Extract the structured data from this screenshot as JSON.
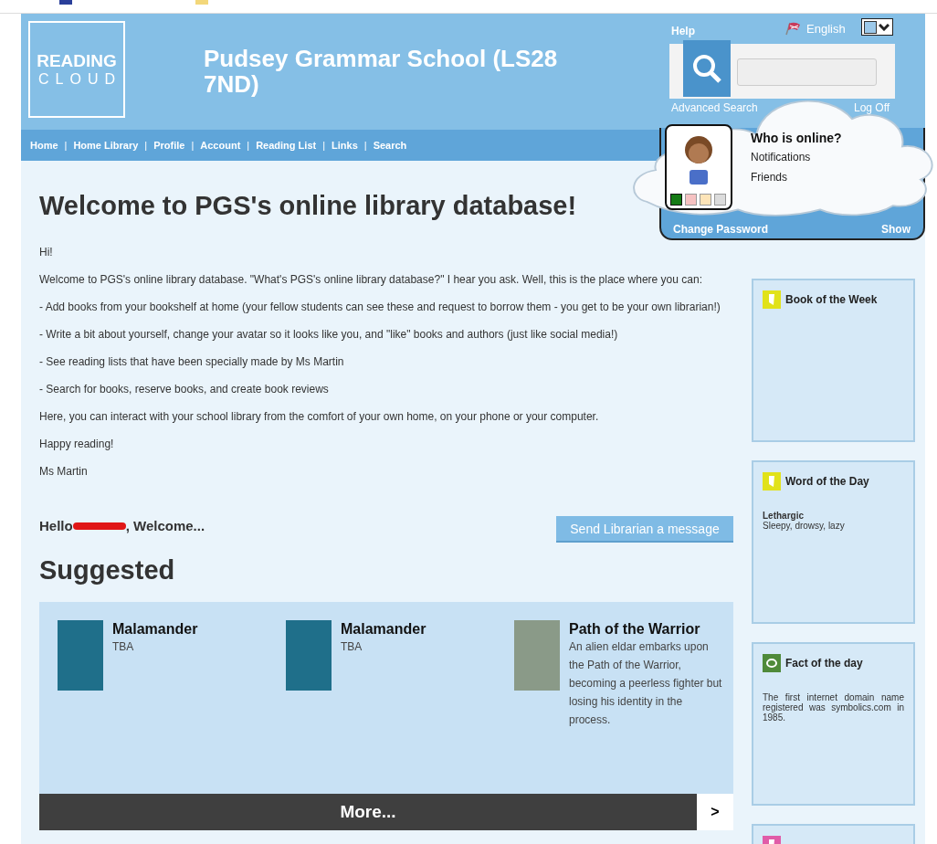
{
  "header": {
    "logo_top": "READING",
    "logo_bottom": "CLOUD",
    "school": "Pudsey Grammar School (LS28 7ND)",
    "help": "Help",
    "language": "English",
    "advanced_search": "Advanced Search",
    "log_off": "Log Off"
  },
  "nav_separator": "|",
  "nav": [
    "Home",
    "Home Library",
    "Profile",
    "Account",
    "Reading List",
    "Links",
    "Search"
  ],
  "user_panel": {
    "title": "Who is online?",
    "links": [
      "Notifications",
      "Friends"
    ],
    "change_password": "Change Password",
    "show": "Show",
    "swatches": [
      {
        "color": "#157a15",
        "selected": true
      },
      {
        "color": "#f6c2c2",
        "selected": false
      },
      {
        "color": "#fde4b8",
        "selected": false
      },
      {
        "color": "#dcdcdc",
        "selected": false
      }
    ]
  },
  "welcome": {
    "title": "Welcome to PGS's online library database!",
    "paragraphs": [
      "Hi!",
      "Welcome to PGS's online library database. \"What's PGS's online library database?\" I hear you ask. Well, this is the place where you can:",
      "- Add books from your bookshelf at home (your fellow students can see these and request to borrow them - you get to be your own librarian!)",
      "- Write a bit about yourself, change your avatar so it looks like you, and \"like\" books and authors (just like social media!)",
      "- See reading lists that have been specially made by Ms Martin",
      "- Search for books, reserve books, and create book reviews",
      "Here, you can interact with your school library from the comfort of your own home, on your phone or your computer.",
      "Happy reading!",
      "Ms Martin"
    ]
  },
  "greeting": {
    "before": "Hello",
    "after": ", Welcome..."
  },
  "message_button": "Send Librarian a message",
  "suggested": {
    "title": "Suggested",
    "books": [
      {
        "title": "Malamander",
        "text": "TBA"
      },
      {
        "title": "Malamander",
        "text": "TBA"
      },
      {
        "title": "Path of the Warrior",
        "text": "An alien eldar embarks upon the Path of the Warrior, becoming a peerless fighter but losing his identity in the process."
      }
    ],
    "more": "More...",
    "next": ">"
  },
  "sidebar": [
    {
      "kind": "book",
      "title": "Book of the Week",
      "color": "#e1e21a"
    },
    {
      "kind": "word",
      "title": "Word of the Day",
      "color": "#e1e21a",
      "word": "Lethargic",
      "meaning": "Sleepy, drowsy, lazy"
    },
    {
      "kind": "fact",
      "title": "Fact of the day",
      "color": "#4f8a3a",
      "text": "The first internet domain name registered was symbolics.com in 1985."
    },
    {
      "kind": "news",
      "color": "#e05ca8"
    }
  ]
}
